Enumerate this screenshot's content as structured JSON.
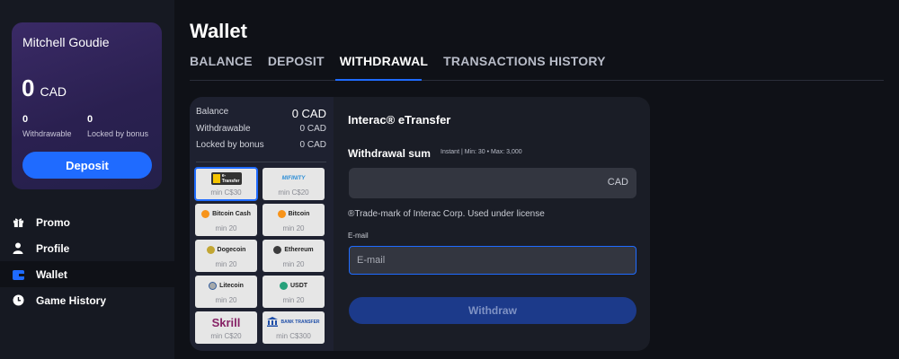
{
  "sidebar": {
    "user_name": "Mitchell Goudie",
    "balance_amount": "0",
    "balance_currency": "CAD",
    "withdrawable_value": "0",
    "withdrawable_label": "Withdrawable",
    "locked_value": "0",
    "locked_label": "Locked by bonus",
    "deposit_label": "Deposit",
    "nav": [
      {
        "label": "Promo",
        "icon": "gift-icon"
      },
      {
        "label": "Profile",
        "icon": "user-icon"
      },
      {
        "label": "Wallet",
        "icon": "wallet-icon",
        "active": true
      },
      {
        "label": "Game History",
        "icon": "clock-icon"
      }
    ]
  },
  "header": {
    "title": "Wallet",
    "tabs": [
      "BALANCE",
      "DEPOSIT",
      "WITHDRAWAL",
      "TRANSACTIONS HISTORY"
    ],
    "active_tab": "WITHDRAWAL"
  },
  "balances": {
    "balance_label": "Balance",
    "balance_value": "0 CAD",
    "withdrawable_label": "Withdrawable",
    "withdrawable_value": "0 CAD",
    "locked_label": "Locked by bonus",
    "locked_value": "0 CAD"
  },
  "methods": [
    {
      "name": "e-Transfer",
      "min": "min C$30",
      "selected": true
    },
    {
      "name": "MIFINITY",
      "min": "min C$20"
    },
    {
      "name": "Bitcoin Cash",
      "min": "min 20"
    },
    {
      "name": "Bitcoin",
      "min": "min 20"
    },
    {
      "name": "Dogecoin",
      "min": "min 20"
    },
    {
      "name": "Ethereum",
      "min": "min 20"
    },
    {
      "name": "Litecoin",
      "min": "min 20"
    },
    {
      "name": "USDT",
      "min": "min 20"
    },
    {
      "name": "Skrill",
      "min": "min C$20"
    },
    {
      "name": "BANK TRANSFER",
      "min": "min C$300"
    }
  ],
  "form": {
    "title": "Interac® eTransfer",
    "sum_label": "Withdrawal sum",
    "sum_hint": "Instant | Min: 30 • Max: 3,000",
    "currency": "CAD",
    "trademark": "®Trade-mark of Interac Corp. Used under license",
    "email_label": "E-mail",
    "email_placeholder": "E-mail",
    "submit_label": "Withdraw"
  },
  "colors": {
    "accent": "#1f6bff",
    "background": "#0f1117",
    "panel": "#1a1d26"
  }
}
